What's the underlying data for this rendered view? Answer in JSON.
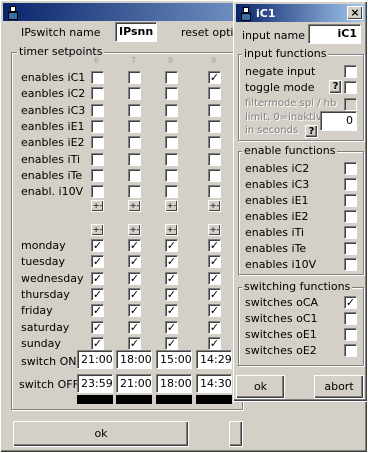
{
  "main_window": {
    "name_label": "IPswitch name",
    "name_value": "IPsnn",
    "reset_label": "reset optio",
    "group_title": "timer setpoints",
    "column_numbers": [
      "6",
      "7",
      "8",
      "9"
    ],
    "enable_rows": [
      {
        "label": "enables iC1",
        "checks": [
          false,
          false,
          false,
          true
        ]
      },
      {
        "label": "eanbles iC2",
        "checks": [
          false,
          false,
          false,
          false
        ]
      },
      {
        "label": "eanbles iC3",
        "checks": [
          false,
          false,
          false,
          false
        ]
      },
      {
        "label": "eanbles iE1",
        "checks": [
          false,
          false,
          false,
          false
        ]
      },
      {
        "label": "eanbles iE2",
        "checks": [
          false,
          false,
          false,
          false
        ]
      },
      {
        "label": "enables iTi",
        "checks": [
          false,
          false,
          false,
          false
        ]
      },
      {
        "label": "enables iTe",
        "checks": [
          false,
          false,
          false,
          false
        ]
      },
      {
        "label": "enabl. i10V",
        "checks": [
          false,
          false,
          false,
          false
        ]
      }
    ],
    "plus_minus": "+-",
    "day_rows": [
      {
        "label": "monday",
        "checks": [
          true,
          true,
          true,
          true
        ]
      },
      {
        "label": "tuesday",
        "checks": [
          true,
          true,
          true,
          true
        ]
      },
      {
        "label": "wednesday",
        "checks": [
          true,
          true,
          true,
          true
        ]
      },
      {
        "label": "thursday",
        "checks": [
          true,
          true,
          true,
          true
        ]
      },
      {
        "label": "friday",
        "checks": [
          true,
          true,
          true,
          true
        ]
      },
      {
        "label": "saturday",
        "checks": [
          true,
          true,
          true,
          true
        ]
      },
      {
        "label": "sunday",
        "checks": [
          true,
          true,
          true,
          true
        ]
      }
    ],
    "switch_on_label": "switch ON",
    "switch_on_values": [
      "21:00",
      "18:00",
      "15:00",
      "14:29"
    ],
    "switch_off_label": "switch OFF",
    "switch_off_values": [
      "23:59",
      "21:00",
      "18:00",
      "14:30"
    ],
    "ok_label": "ok"
  },
  "dialog": {
    "title": "iC1",
    "close_glyph": "×",
    "input_name_label": "input name",
    "input_name_value": "iC1",
    "input_functions_title": "input functions",
    "negate_input": "negate input",
    "toggle_mode": "toggle mode",
    "help_glyph": "?",
    "filtermode": "filtermode spi / hb",
    "limit_line1": "limit, 0=inaktiv",
    "limit_line2": "in seconds",
    "limit_value": "0",
    "enable_functions_title": "enable functions",
    "enable_items": [
      {
        "label": "enables iC2",
        "checked": false
      },
      {
        "label": "enables iC3",
        "checked": false
      },
      {
        "label": "enables iE1",
        "checked": false
      },
      {
        "label": "enables iE2",
        "checked": false
      },
      {
        "label": "enables iTi",
        "checked": false
      },
      {
        "label": "enables iTe",
        "checked": false
      },
      {
        "label": "enables i10V",
        "checked": false
      }
    ],
    "switching_functions_title": "switching functions",
    "switching_items": [
      {
        "label": "switches oCA",
        "checked": true
      },
      {
        "label": "switches oC1",
        "checked": false
      },
      {
        "label": "switches oE1",
        "checked": false
      },
      {
        "label": "switches oE2",
        "checked": false
      }
    ],
    "ok_label": "ok",
    "abort_label": "abort"
  },
  "colors": {
    "titlebar_active": "#0a246a",
    "titlebar_gradient_end": "#a6caf0",
    "face": "#d4d0c8"
  }
}
